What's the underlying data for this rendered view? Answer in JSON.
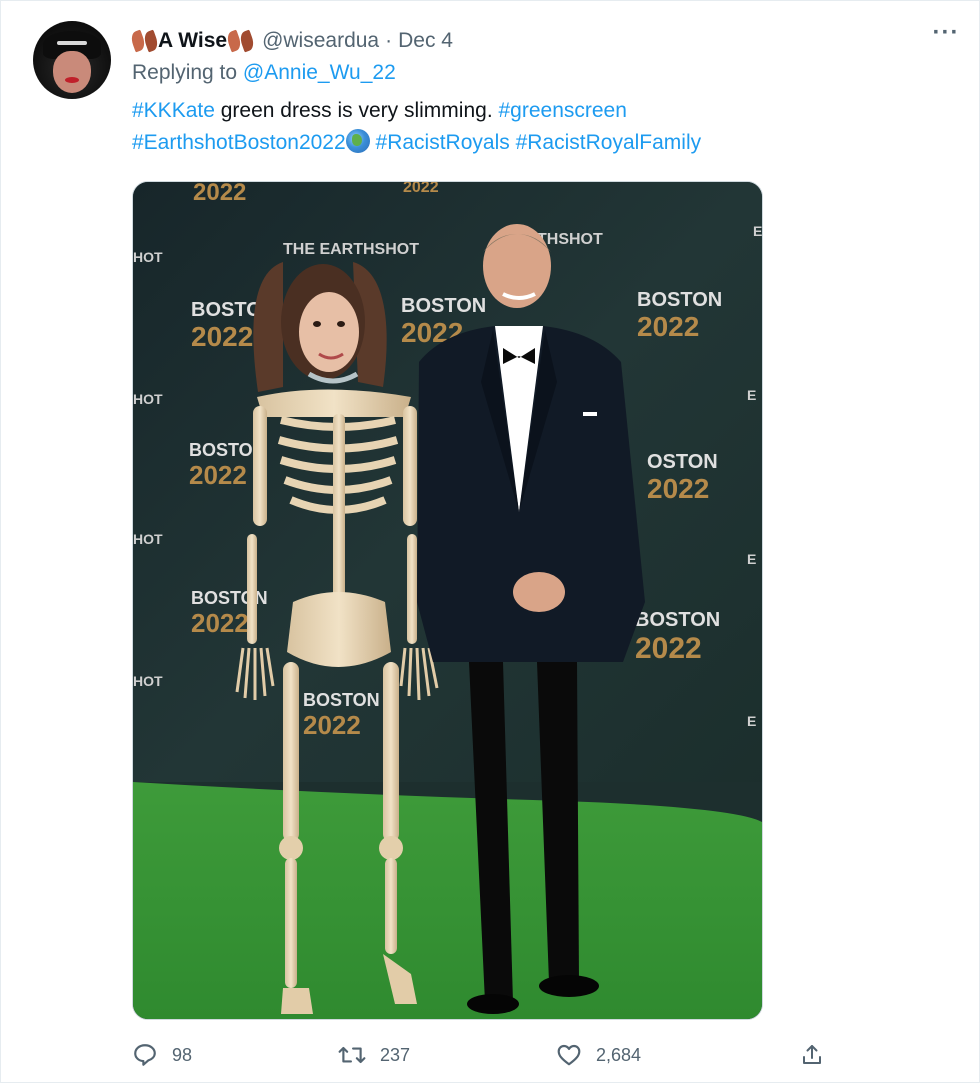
{
  "tweet": {
    "display_name": "A Wise",
    "handle": "@wiseardua",
    "separator": "·",
    "date": "Dec 4",
    "replying_prefix": "Replying to",
    "replying_to": "@Annie_Wu_22",
    "text": {
      "hashtag_kkkate": "#KKKate",
      "plain_1": " green dress is very slimming. ",
      "hashtag_greenscreen": "#greenscreen",
      "hashtag_earthshot": "#EarthshotBoston2022",
      "hashtag_racistroyals": "#RacistRoyals",
      "hashtag_racistroyalfamily": "#RacistRoyalFamily"
    },
    "more_label": "···",
    "stats": {
      "replies": "98",
      "retweets": "237",
      "likes": "2,684"
    },
    "media": {
      "backdrop_brand": "THE EARTHSHOT",
      "backdrop_brand_right": "THSHOT",
      "backdrop_city": "BOSTON",
      "backdrop_year": "2022",
      "backdrop_fragment_hot": "HOT",
      "backdrop_fragment_e": "E",
      "backdrop_fragment_oston": "OSTON"
    }
  },
  "colors": {
    "link": "#1d9bf0",
    "muted": "#536471",
    "text": "#0f1419",
    "carpet": "#3a9a3a",
    "backdrop": "#1f3232",
    "gold": "#b58a4a"
  },
  "icons": {
    "reply": "reply-icon",
    "retweet": "retweet-icon",
    "like": "heart-icon",
    "share": "share-icon",
    "more": "more-icon"
  }
}
